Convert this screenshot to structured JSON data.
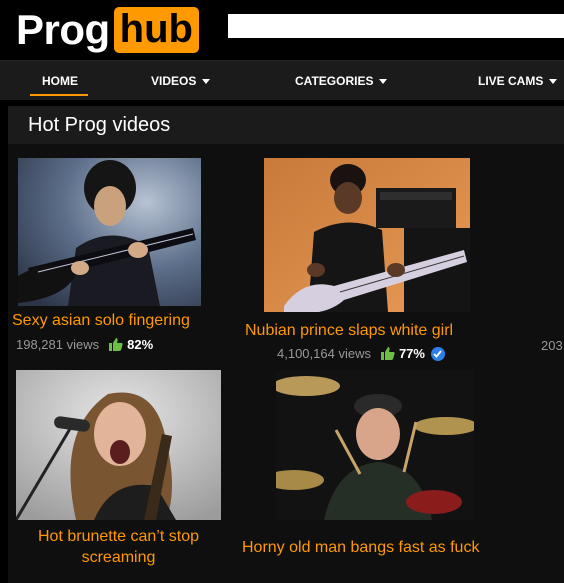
{
  "header": {
    "logo_text_white": "Prog",
    "logo_text_badge": "hub",
    "search": {
      "value": "",
      "placeholder": ""
    }
  },
  "nav": {
    "items": [
      {
        "label": "HOME",
        "active": true,
        "dropdown": false
      },
      {
        "label": "VIDEOS",
        "active": false,
        "dropdown": true
      },
      {
        "label": "CATEGORIES",
        "active": false,
        "dropdown": true
      },
      {
        "label": "LIVE CAMS",
        "active": false,
        "dropdown": true
      }
    ]
  },
  "section": {
    "title": "Hot Prog videos"
  },
  "videos": [
    {
      "title": "Sexy asian solo fingering",
      "views": "198,281 views",
      "rating": "82%",
      "verified": false
    },
    {
      "title": "Nubian prince slaps white girl",
      "views": "4,100,164 views",
      "rating": "77%",
      "verified": true
    },
    {
      "title": "Hot brunette can’t stop screaming"
    },
    {
      "title": "Horny old man bangs fast as fuck"
    }
  ],
  "cutoff_views": "203",
  "colors": {
    "accent": "#ff9900",
    "background": "#000000",
    "nav_bg": "#1b1b1b",
    "rating_green": "#6cbe45",
    "verified_blue": "#2d7fe8"
  }
}
